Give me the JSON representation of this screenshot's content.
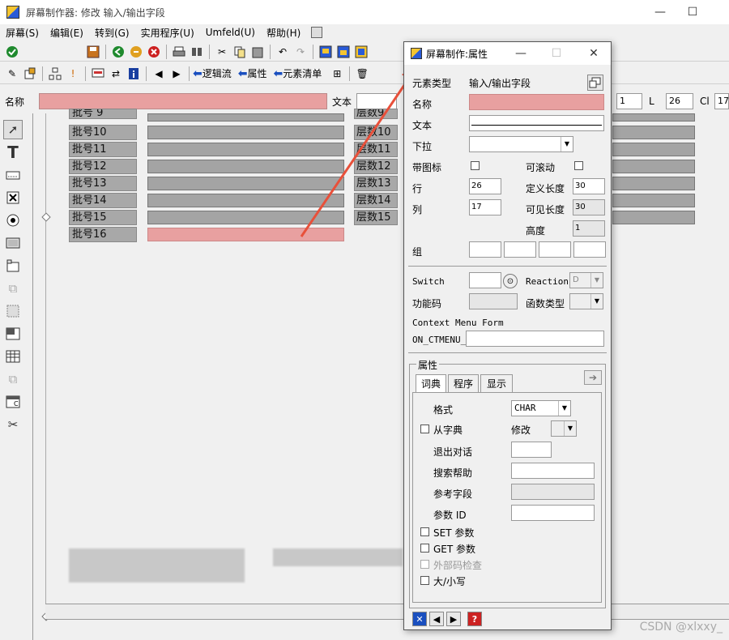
{
  "window": {
    "title": "屏幕制作器:   修改 输入/输出字段",
    "controls": {
      "minimize": "—",
      "maximize": "☐"
    }
  },
  "menu": [
    "屏幕(S)",
    "编辑(E)",
    "转到(G)",
    "实用程序(U)",
    "Umfeld(U)",
    "帮助(H)"
  ],
  "toolbar2": {
    "logic_flow": "逻辑流",
    "attributes": "属性",
    "element_list": "元素清单"
  },
  "namebar": {
    "name_label": "名称",
    "text_label": "文本",
    "line_value": "1",
    "l_label": "L",
    "l_value": "26",
    "cl_label": "Cl",
    "cl_value": "17"
  },
  "canvas": {
    "row_labels": [
      "批号 9",
      "批号10",
      "批号11",
      "批号12",
      "批号13",
      "批号14",
      "批号15",
      "批号16"
    ],
    "layer_labels": [
      "层数9",
      "层数10",
      "层数11",
      "层数12",
      "层数13",
      "层数14",
      "层数15"
    ]
  },
  "dialog": {
    "title": "屏幕制作:属性",
    "close": "✕",
    "maximize": "☐",
    "minimize": "—",
    "element_type_label": "元素类型",
    "element_type_value": "输入/输出字段",
    "name_label": "名称",
    "text_label": "文本",
    "dropdown_label": "下拉",
    "with_icon_label": "带图标",
    "scrollable_label": "可滚动",
    "row_label": "行",
    "row_value": "26",
    "def_length_label": "定义长度",
    "def_length_value": "30",
    "col_label": "列",
    "col_value": "17",
    "vis_length_label": "可见长度",
    "vis_length_value": "30",
    "height_label": "高度",
    "height_value": "1",
    "group_label": "组",
    "switch_label": "Switch",
    "reaction_label": "Reaction",
    "reaction_value": "D",
    "function_code_label": "功能码",
    "function_type_label": "函数类型",
    "context_menu_label": "Context Menu Form",
    "on_ctmenu_label": "ON_CTMENU_",
    "props_group_title": "属性",
    "tabs": [
      "词典",
      "程序",
      "显示"
    ],
    "format_label": "格式",
    "format_value": "CHAR",
    "from_dict_label": "从字典",
    "modify_label": "修改",
    "exit_dialog_label": "退出对话",
    "search_help_label": "搜索帮助",
    "ref_field_label": "参考字段",
    "param_id_label": "参数 ID",
    "set_param_label": "SET 参数",
    "get_param_label": "GET 参数",
    "foreign_key_label": "外部码检查",
    "upper_lower_label": "大/小写"
  },
  "watermark": "CSDN @xlxxy_",
  "colors": {
    "selected_field": "#e8a0a0",
    "field_grey": "#a4a4a4",
    "annotation_arrow": "#e8503a"
  }
}
